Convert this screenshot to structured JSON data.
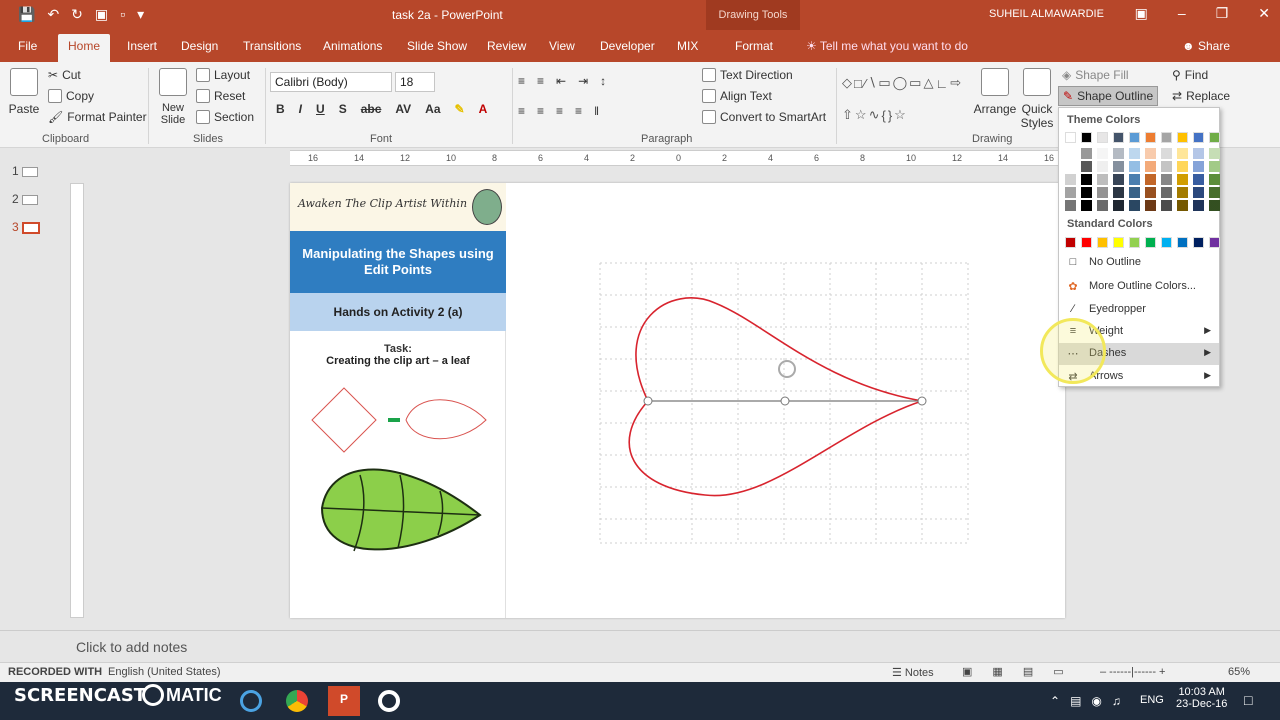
{
  "title_bar": {
    "doc_title": "task 2a - PowerPoint",
    "context": "Drawing Tools",
    "user": "SUHEIL ALMAWARDIE"
  },
  "tabs": [
    {
      "label": "File"
    },
    {
      "label": "Home"
    },
    {
      "label": "Insert"
    },
    {
      "label": "Design"
    },
    {
      "label": "Transitions"
    },
    {
      "label": "Animations"
    },
    {
      "label": "Slide Show"
    },
    {
      "label": "Review"
    },
    {
      "label": "View"
    },
    {
      "label": "Developer"
    },
    {
      "label": "MIX"
    },
    {
      "label": "Format"
    }
  ],
  "tell_me": "Tell me what you want to do",
  "share": "Share",
  "ribbon": {
    "clipboard": {
      "paste": "Paste",
      "cut": "Cut",
      "copy": "Copy",
      "format_painter": "Format Painter",
      "label": "Clipboard"
    },
    "slides": {
      "new_slide": "New Slide",
      "layout": "Layout",
      "reset": "Reset",
      "section": "Section",
      "label": "Slides"
    },
    "font": {
      "name": "Calibri (Body)",
      "size": "18",
      "label": "Font"
    },
    "paragraph": {
      "text_direction": "Text Direction",
      "align_text": "Align Text",
      "smartart": "Convert to SmartArt",
      "label": "Paragraph"
    },
    "drawing": {
      "arrange": "Arrange",
      "quick_styles": "Quick Styles",
      "shape_fill": "Shape Fill",
      "shape_outline": "Shape Outline",
      "label": "Drawing"
    },
    "editing": {
      "find": "Find",
      "replace": "Replace"
    }
  },
  "ruler_ticks": [
    "16",
    "14",
    "12",
    "10",
    "8",
    "6",
    "4",
    "2",
    "0",
    "2",
    "4",
    "6",
    "8",
    "10",
    "12",
    "14",
    "16"
  ],
  "thumbnails": [
    "1",
    "2",
    "3"
  ],
  "slide": {
    "header": "Awaken The Clip Artist Within",
    "banner": "Manipulating the Shapes using Edit Points",
    "subbanner": "Hands on Activity 2 (a)",
    "task_label": "Task:",
    "task_text": "Creating the clip art – a leaf"
  },
  "dropdown": {
    "theme_colors": "Theme Colors",
    "standard_colors": "Standard Colors",
    "no_outline": "No Outline",
    "more_colors": "More Outline Colors...",
    "eyedropper": "Eyedropper",
    "weight": "Weight",
    "dashes": "Dashes",
    "arrows": "Arrows",
    "theme_swatches": [
      "#ffffff",
      "#000000",
      "#e7e6e6",
      "#44546a",
      "#5b9bd5",
      "#ed7d31",
      "#a5a5a5",
      "#ffc000",
      "#4472c4",
      "#70ad47"
    ],
    "standard_swatches": [
      "#c00000",
      "#ff0000",
      "#ffc000",
      "#ffff00",
      "#92d050",
      "#00b050",
      "#00b0f0",
      "#0070c0",
      "#002060",
      "#7030a0"
    ]
  },
  "notes": "Click to add notes",
  "status": {
    "recorded": "RECORDED WITH",
    "language": "English (United States)",
    "notes_btn": "Notes",
    "zoom": "65%"
  },
  "taskbar": {
    "brand": "SCREENCAST",
    "brand2": "MATIC",
    "time": "10:03 AM",
    "date": "23-Dec-16",
    "lang": "ENG"
  }
}
